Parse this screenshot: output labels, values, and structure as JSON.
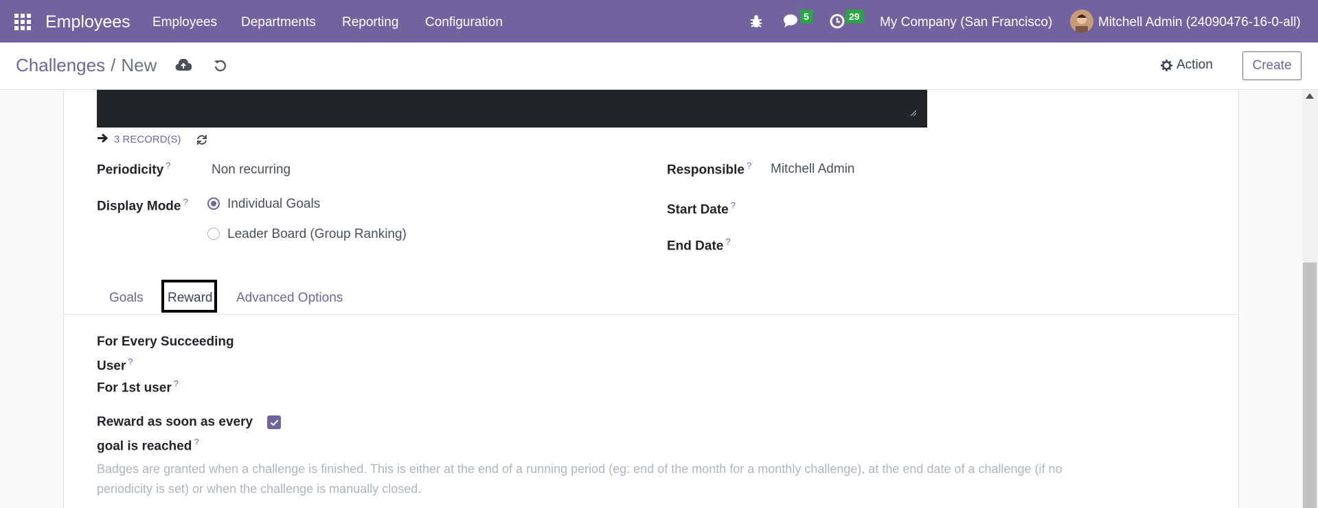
{
  "topbar": {
    "app_title": "Employees",
    "menu": [
      "Employees",
      "Departments",
      "Reporting",
      "Configuration"
    ],
    "messages_count": "5",
    "activities_count": "29",
    "company": "My Company (San Francisco)",
    "user": "Mitchell Admin (24090476-16-0-all)"
  },
  "controlbar": {
    "breadcrumb_parent": "Challenges",
    "breadcrumb_separator": "/",
    "breadcrumb_current": "New",
    "action_label": "Action",
    "create_label": "Create"
  },
  "records_label": "3 RECORD(S)",
  "fields": {
    "periodicity_label": "Periodicity",
    "periodicity_value": "Non recurring",
    "display_mode_label": "Display Mode",
    "display_mode_options": [
      "Individual Goals",
      "Leader Board (Group Ranking)"
    ],
    "display_mode_selected": "Individual Goals",
    "responsible_label": "Responsible",
    "responsible_value": "Mitchell Admin",
    "start_date_label": "Start Date",
    "end_date_label": "End Date",
    "help_marker": "?"
  },
  "tabs": [
    "Goals",
    "Reward",
    "Advanced Options"
  ],
  "active_tab": "Reward",
  "reward": {
    "every_user_label_line1": "For Every Succeeding",
    "every_user_label_line2": "User",
    "first_user_label": "For 1st user",
    "reward_asap_label_line1": "Reward as soon as every",
    "reward_asap_label_line2": "goal is reached",
    "reward_asap_checked": true,
    "help_text_line1": "Badges are granted when a challenge is finished. This is either at the end of a running period (eg: end of the month for a monthly challenge), at the end date of a challenge (if no",
    "help_text_line2": "periodicity is set) or when the challenge is manually closed."
  },
  "colors": {
    "brand": "#71639e",
    "badge": "#28a745"
  }
}
